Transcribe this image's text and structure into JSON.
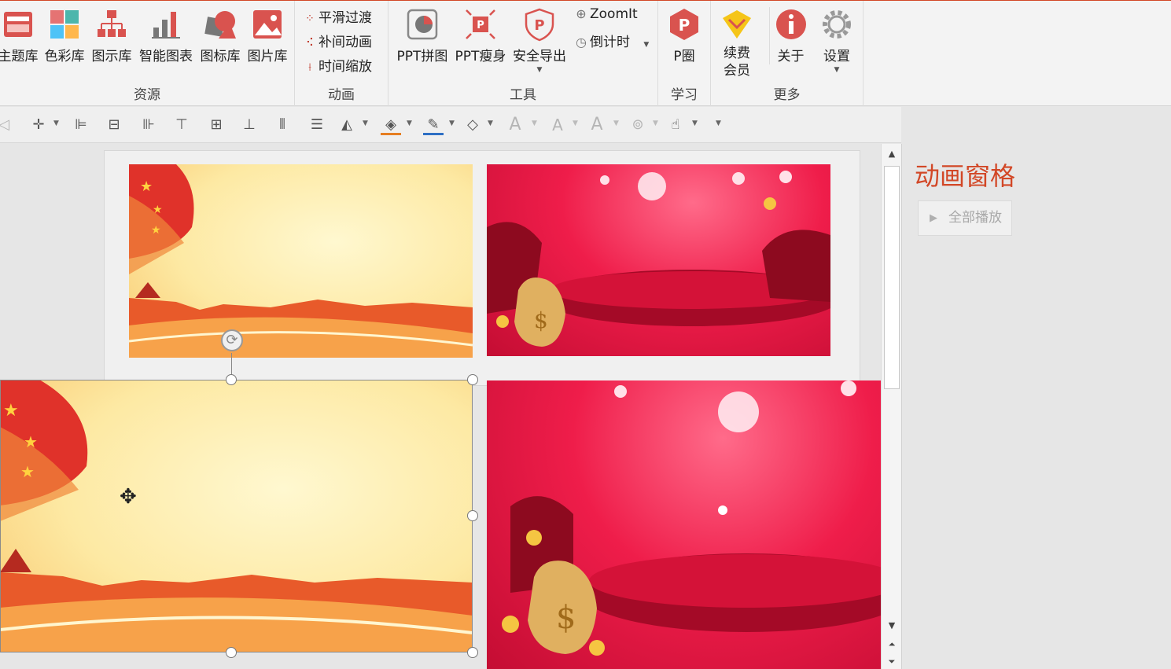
{
  "ribbon": {
    "groups": {
      "resources": {
        "label": "资源",
        "buttons": [
          "主题库",
          "色彩库",
          "图示库",
          "智能图表",
          "图标库",
          "图片库"
        ]
      },
      "animation": {
        "label": "动画",
        "buttons": [
          "平滑过渡",
          "补间动画",
          "时间缩放"
        ]
      },
      "tools": {
        "label": "工具",
        "big": [
          "PPT拼图",
          "PPT瘦身",
          "安全导出"
        ],
        "small": [
          "ZoomIt",
          "倒计时"
        ]
      },
      "learn": {
        "label": "学习",
        "buttons": [
          "P圈"
        ]
      },
      "more": {
        "label": "更多",
        "buttons": [
          "续费\n会员",
          "关于",
          "设置"
        ]
      }
    }
  },
  "pane": {
    "title": "动画窗格",
    "play_all": "全部播放"
  },
  "colors": {
    "accent": "#d24726",
    "ribbon_bg": "#f3f3f3"
  },
  "icons": [
    "theme-icon",
    "color-icon",
    "diagram-icon",
    "chart-icon",
    "icon-lib-icon",
    "picture-icon",
    "smooth-icon",
    "tween-icon",
    "time-scale-icon",
    "puzzle-icon",
    "slim-icon",
    "shield-icon",
    "zoom-icon",
    "timer-icon",
    "pcircle-icon",
    "crown-icon",
    "info-icon",
    "gear-icon"
  ]
}
